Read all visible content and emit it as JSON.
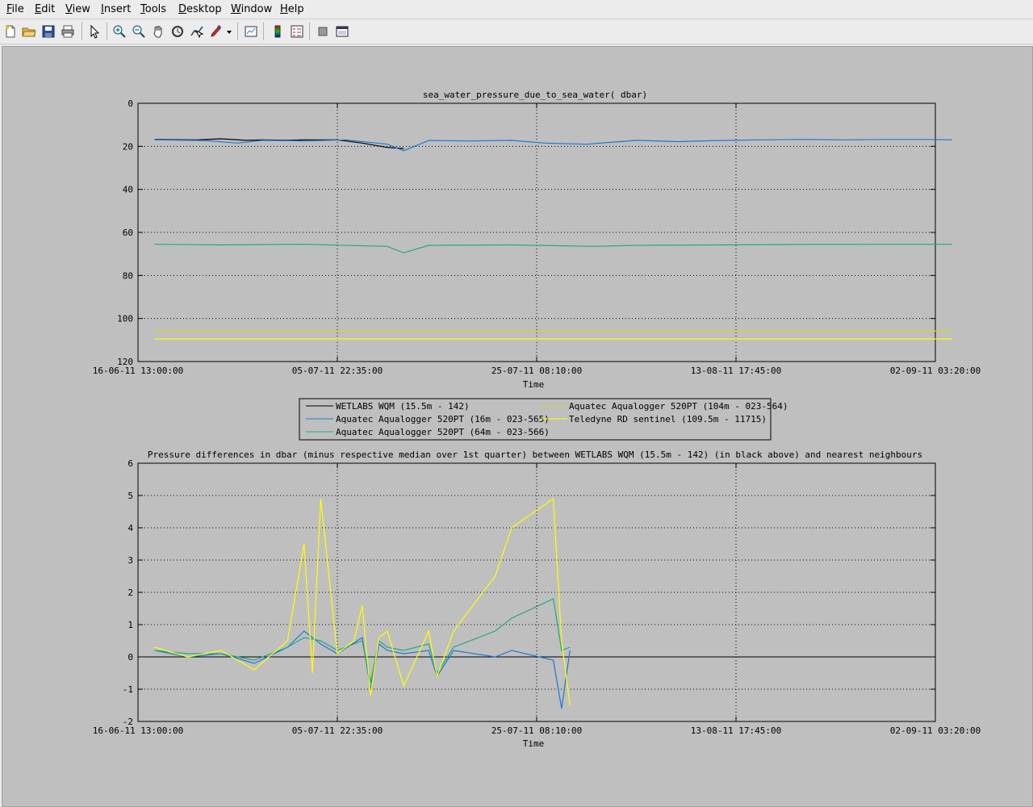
{
  "menu": {
    "items": [
      {
        "label": "File",
        "key": "F",
        "rest": "ile"
      },
      {
        "label": "Edit",
        "key": "E",
        "rest": "dit"
      },
      {
        "label": "View",
        "key": "V",
        "rest": "iew"
      },
      {
        "label": "Insert",
        "key": "I",
        "rest": "nsert"
      },
      {
        "label": "Tools",
        "key": "T",
        "rest": "ools"
      },
      {
        "label": "Desktop",
        "key": "D",
        "rest": "esktop"
      },
      {
        "label": "Window",
        "key": "W",
        "rest": "indow"
      },
      {
        "label": "Help",
        "key": "H",
        "rest": "elp"
      }
    ]
  },
  "toolbar": {
    "icons": [
      "new-file-icon",
      "open-folder-icon",
      "save-icon",
      "print-icon",
      "pointer-icon",
      "zoom-in-icon",
      "zoom-out-icon",
      "pan-hand-icon",
      "rotate-3d-icon",
      "data-cursor-icon",
      "brush-icon",
      "brush-dropdown-icon",
      "link-plot-icon",
      "colorbar-icon",
      "legend-icon",
      "hide-plot-tools-icon",
      "show-plot-tools-icon"
    ]
  },
  "colors": {
    "background": "#bfbfbf",
    "wqm": "#000000",
    "aq16": "#1f78d1",
    "aq64": "#1fa888",
    "aq104": "#d8d22a",
    "teledyne": "#ffff00"
  },
  "chart_data": [
    {
      "type": "line",
      "title": "sea_water_pressure_due_to_sea_water( dbar)",
      "xlabel": "Time",
      "ylabel": "",
      "x_tick_labels": [
        "16-06-11 13:00:00",
        "05-07-11 22:35:00",
        "25-07-11 08:10:00",
        "13-08-11 17:45:00",
        "02-09-11 03:20:00"
      ],
      "y_ticks": [
        0,
        20,
        40,
        60,
        80,
        100,
        120
      ],
      "ylim": [
        0,
        120
      ],
      "y_reversed": true,
      "grid": true,
      "series": [
        {
          "name": "WETLABS WQM (15.5m - 142)",
          "x_days": [
            2,
            7,
            10,
            13,
            15,
            18,
            20,
            24,
            27,
            30,
            32
          ],
          "values": [
            16.8,
            17.0,
            16.5,
            17.2,
            17.0,
            17.2,
            17.0,
            17.0,
            18.5,
            20.5,
            21.0
          ]
        },
        {
          "name": "Aquatec Aqualogger 520PT (16m - 023-565)",
          "x_days": [
            2,
            8,
            12,
            15,
            20,
            25,
            30,
            32,
            35,
            40,
            45,
            49,
            54,
            60,
            65,
            70,
            75,
            80,
            85,
            90,
            95,
            98
          ],
          "values": [
            17.0,
            17.3,
            18.5,
            17.2,
            17.5,
            17.0,
            19.0,
            22.0,
            17.3,
            17.5,
            17.2,
            18.5,
            19.0,
            17.2,
            17.8,
            17.3,
            17.0,
            16.8,
            17.0,
            16.8,
            16.8,
            17.0
          ]
        },
        {
          "name": "Aquatec Aqualogger 520PT (64m - 023-566)",
          "x_days": [
            2,
            10,
            20,
            30,
            32,
            35,
            45,
            55,
            60,
            70,
            80,
            90,
            98
          ],
          "values": [
            65.5,
            65.8,
            65.5,
            66.5,
            69.5,
            66.0,
            65.8,
            66.5,
            66.0,
            65.8,
            65.6,
            65.5,
            65.5
          ],
          "pressure_axis_note": ""
        },
        {
          "name": "Aquatec Aqualogger 520PT (104m - 023-564)",
          "x_days": [
            2,
            25,
            50,
            75,
            98
          ],
          "values": [
            105.8,
            105.8,
            105.8,
            105.8,
            105.8
          ]
        },
        {
          "name": "Teledyne RD sentinel (109.5m - 11715)",
          "x_days": [
            2,
            25,
            50,
            75,
            98
          ],
          "values": [
            109.5,
            109.5,
            109.5,
            109.5,
            109.5
          ]
        }
      ],
      "legend": "below"
    },
    {
      "type": "line",
      "title": "Pressure differences in dbar (minus respective median over 1st quarter) between WETLABS WQM (15.5m - 142) (in black above) and nearest neighbours",
      "xlabel": "Time",
      "ylabel": "",
      "x_tick_labels": [
        "16-06-11 13:00:00",
        "05-07-11 22:35:00",
        "25-07-11 08:10:00",
        "13-08-11 17:45:00",
        "02-09-11 03:20:00"
      ],
      "y_ticks": [
        -2,
        -1,
        0,
        1,
        2,
        3,
        4,
        5,
        6
      ],
      "ylim": [
        -2,
        6
      ],
      "grid": true,
      "zero_line": true,
      "series": [
        {
          "name": "Aquatec Aqualogger 520PT (16m - 023-565)",
          "x_days": [
            2,
            6,
            10,
            14,
            18,
            20,
            22,
            24,
            27,
            28,
            29,
            30,
            32,
            35,
            36,
            38,
            43,
            45,
            50,
            51,
            52
          ],
          "values": [
            0.2,
            0.0,
            0.1,
            -0.2,
            0.3,
            0.8,
            0.4,
            0.1,
            0.6,
            -1.0,
            0.4,
            0.2,
            0.1,
            0.2,
            -0.6,
            0.2,
            0.0,
            0.2,
            -0.1,
            -1.6,
            0.2
          ]
        },
        {
          "name": "Aquatec Aqualogger 520PT (64m - 023-566)",
          "x_days": [
            2,
            6,
            10,
            14,
            18,
            20,
            22,
            24,
            27,
            28,
            29,
            30,
            32,
            35,
            36,
            38,
            43,
            45,
            50,
            51,
            52
          ],
          "values": [
            0.2,
            0.1,
            0.1,
            -0.1,
            0.3,
            0.6,
            0.5,
            0.2,
            0.5,
            -0.8,
            0.5,
            0.3,
            0.2,
            0.4,
            -0.5,
            0.3,
            0.8,
            1.2,
            1.8,
            0.2,
            0.3
          ]
        },
        {
          "name": "Teledyne RD sentinel (109.5m - 11715)",
          "x_days": [
            2,
            6,
            10,
            14,
            18,
            20,
            21,
            22,
            24,
            26,
            27,
            28,
            29,
            30,
            32,
            35,
            36,
            38,
            43,
            45,
            50,
            51,
            52
          ],
          "values": [
            0.3,
            0.0,
            0.2,
            -0.4,
            0.5,
            3.5,
            -0.5,
            4.9,
            0.1,
            0.5,
            1.6,
            -1.2,
            0.6,
            0.8,
            -0.9,
            0.8,
            -0.6,
            0.8,
            2.5,
            4.0,
            4.9,
            0.5,
            -1.5
          ]
        }
      ]
    }
  ]
}
